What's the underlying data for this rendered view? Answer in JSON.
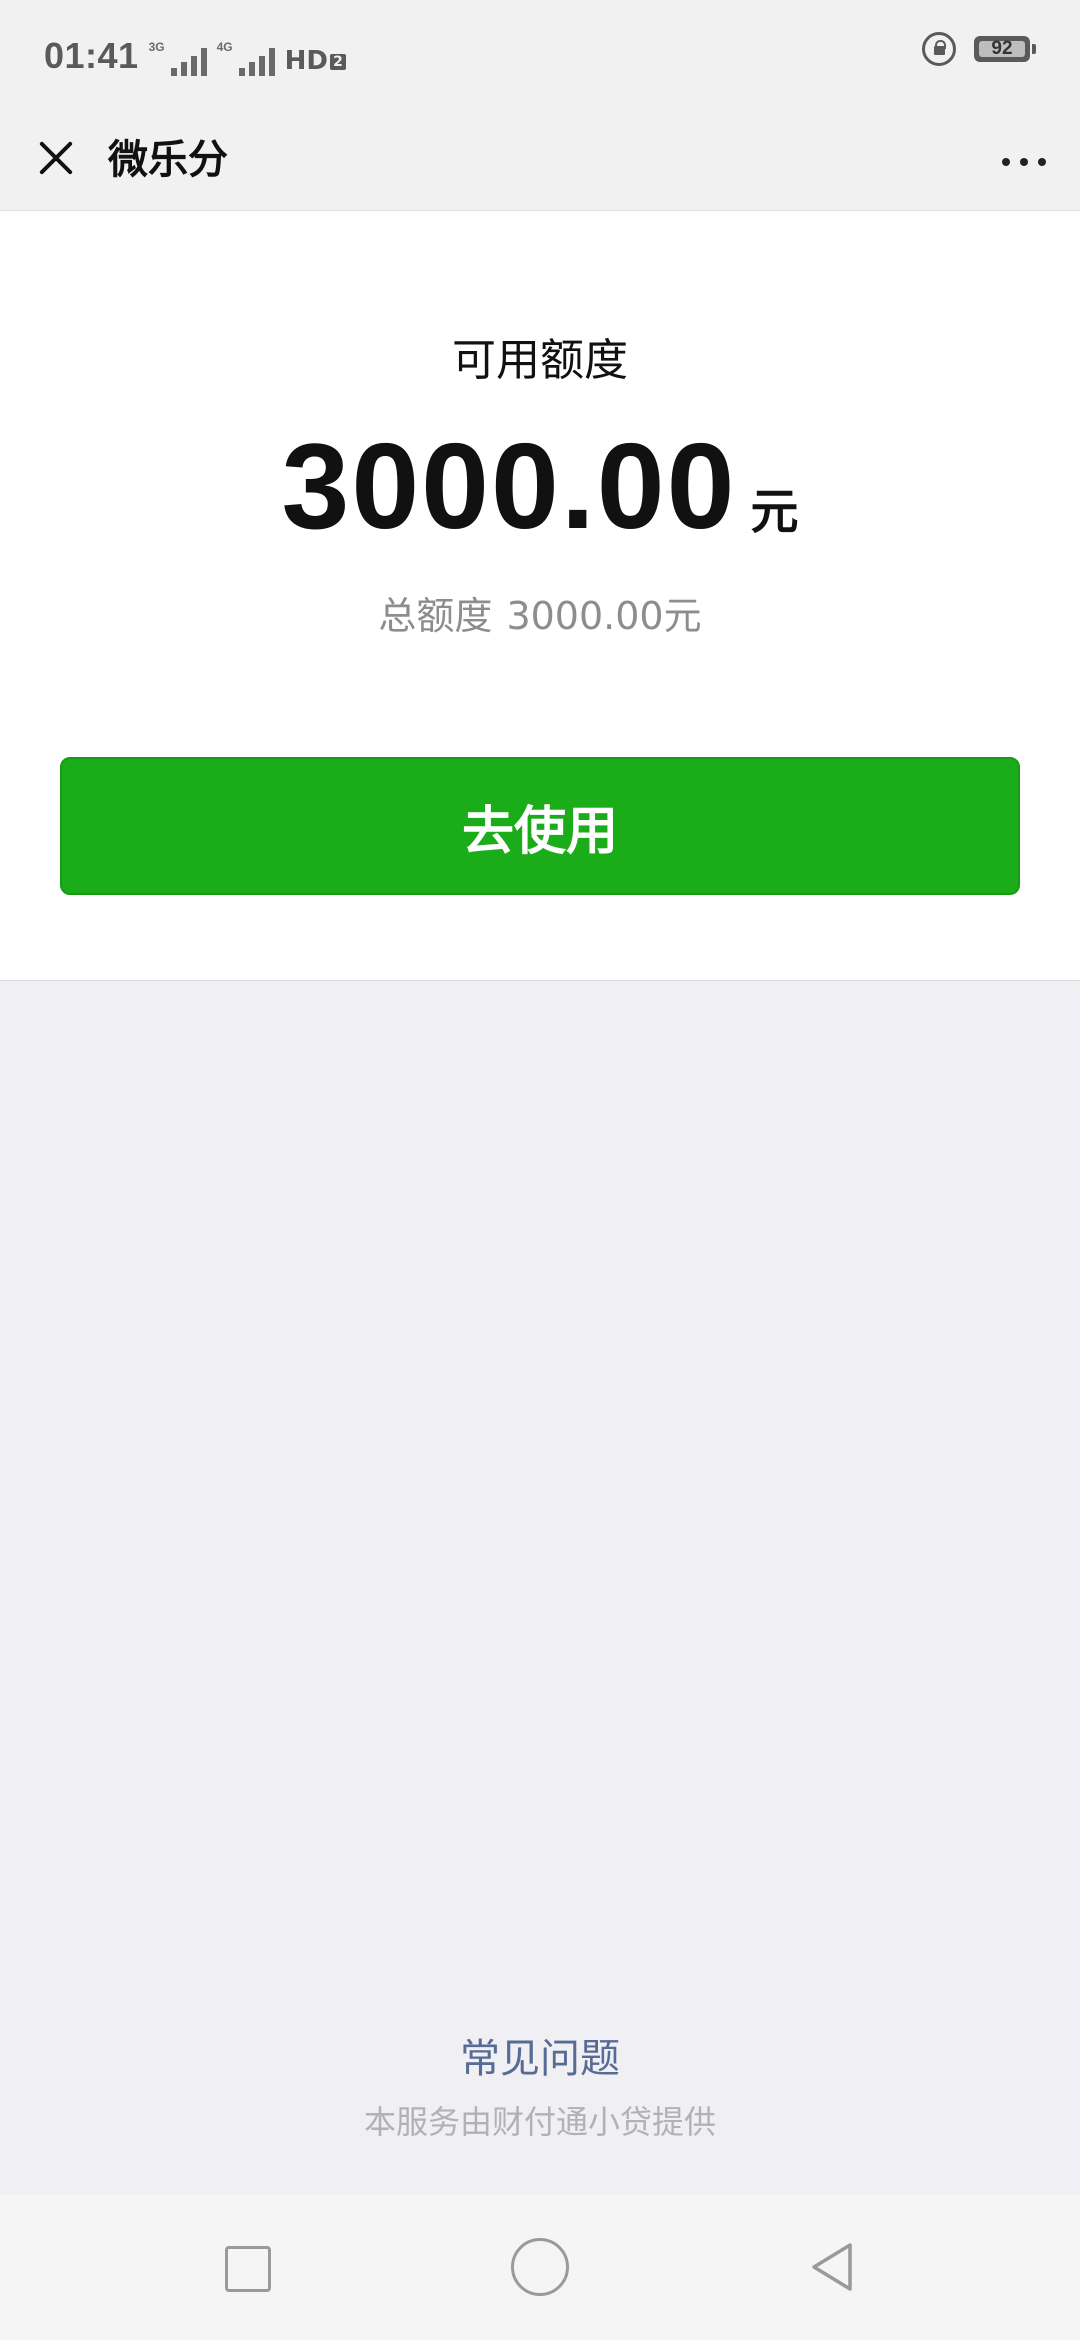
{
  "status_bar": {
    "time": "01:41",
    "signal_1_tag": "3G",
    "signal_2_tag": "4G",
    "hd_label": "HD",
    "hd_sub": "2",
    "battery_level": "92",
    "icons": [
      "signal-icon",
      "signal-icon",
      "hd-call-icon",
      "rotation-lock-icon",
      "battery-icon"
    ]
  },
  "nav": {
    "title": "微乐分",
    "close_icon": "close-icon",
    "more_icon": "more-icon"
  },
  "credit": {
    "available_label": "可用额度",
    "available_amount": "3000.00",
    "unit": "元",
    "total_label": "总额度",
    "total_amount": "3000.00元"
  },
  "actions": {
    "use_button_label": "去使用"
  },
  "footer": {
    "faq_label": "常见问题",
    "provider_note": "本服务由财付通小贷提供"
  },
  "colors": {
    "primary_green": "#1aad19",
    "link_blue": "#576b95",
    "background": "#efeff4"
  },
  "system_nav": {
    "icons": [
      "recent-apps-icon",
      "home-icon",
      "back-icon"
    ]
  }
}
